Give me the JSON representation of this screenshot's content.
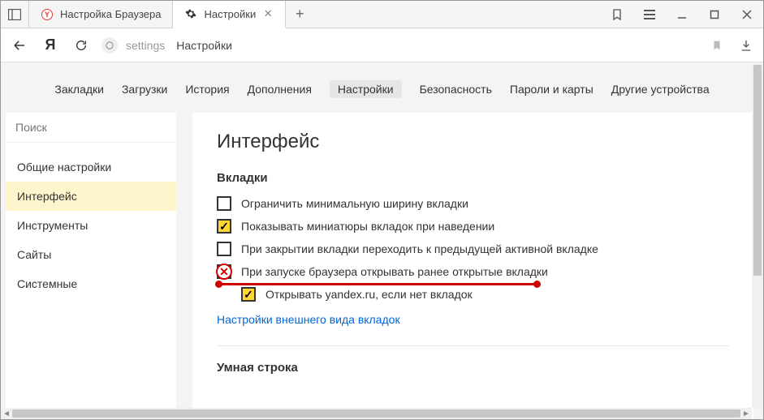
{
  "titlebar": {
    "tabs": [
      {
        "label": "Настройка Браузера",
        "icon": "yandex-y-icon",
        "active": false
      },
      {
        "label": "Настройки",
        "icon": "gear-icon",
        "active": true
      }
    ]
  },
  "addressbar": {
    "path": "settings",
    "title": "Настройки"
  },
  "topnav": {
    "items": [
      {
        "label": "Закладки"
      },
      {
        "label": "Загрузки"
      },
      {
        "label": "История"
      },
      {
        "label": "Дополнения"
      },
      {
        "label": "Настройки",
        "active": true
      },
      {
        "label": "Безопасность"
      },
      {
        "label": "Пароли и карты"
      },
      {
        "label": "Другие устройства"
      }
    ]
  },
  "sidebar": {
    "search_placeholder": "Поиск",
    "items": [
      {
        "label": "Общие настройки"
      },
      {
        "label": "Интерфейс",
        "active": true
      },
      {
        "label": "Инструменты"
      },
      {
        "label": "Сайты"
      },
      {
        "label": "Системные"
      }
    ]
  },
  "main": {
    "heading": "Интерфейс",
    "section1_title": "Вкладки",
    "checks": [
      {
        "label": "Ограничить минимальную ширину вкладки",
        "checked": false
      },
      {
        "label": "Показывать миниатюры вкладок при наведении",
        "checked": true
      },
      {
        "label": "При закрытии вкладки переходить к предыдущей активной вкладке",
        "checked": false
      },
      {
        "label": "При запуске браузера открывать ранее открытые вкладки",
        "checked": false,
        "annotated": true
      },
      {
        "label": "Открывать yandex.ru, если нет вкладок",
        "checked": true,
        "indent": true
      }
    ],
    "link": "Настройки внешнего вида вкладок",
    "section2_title": "Умная строка"
  }
}
